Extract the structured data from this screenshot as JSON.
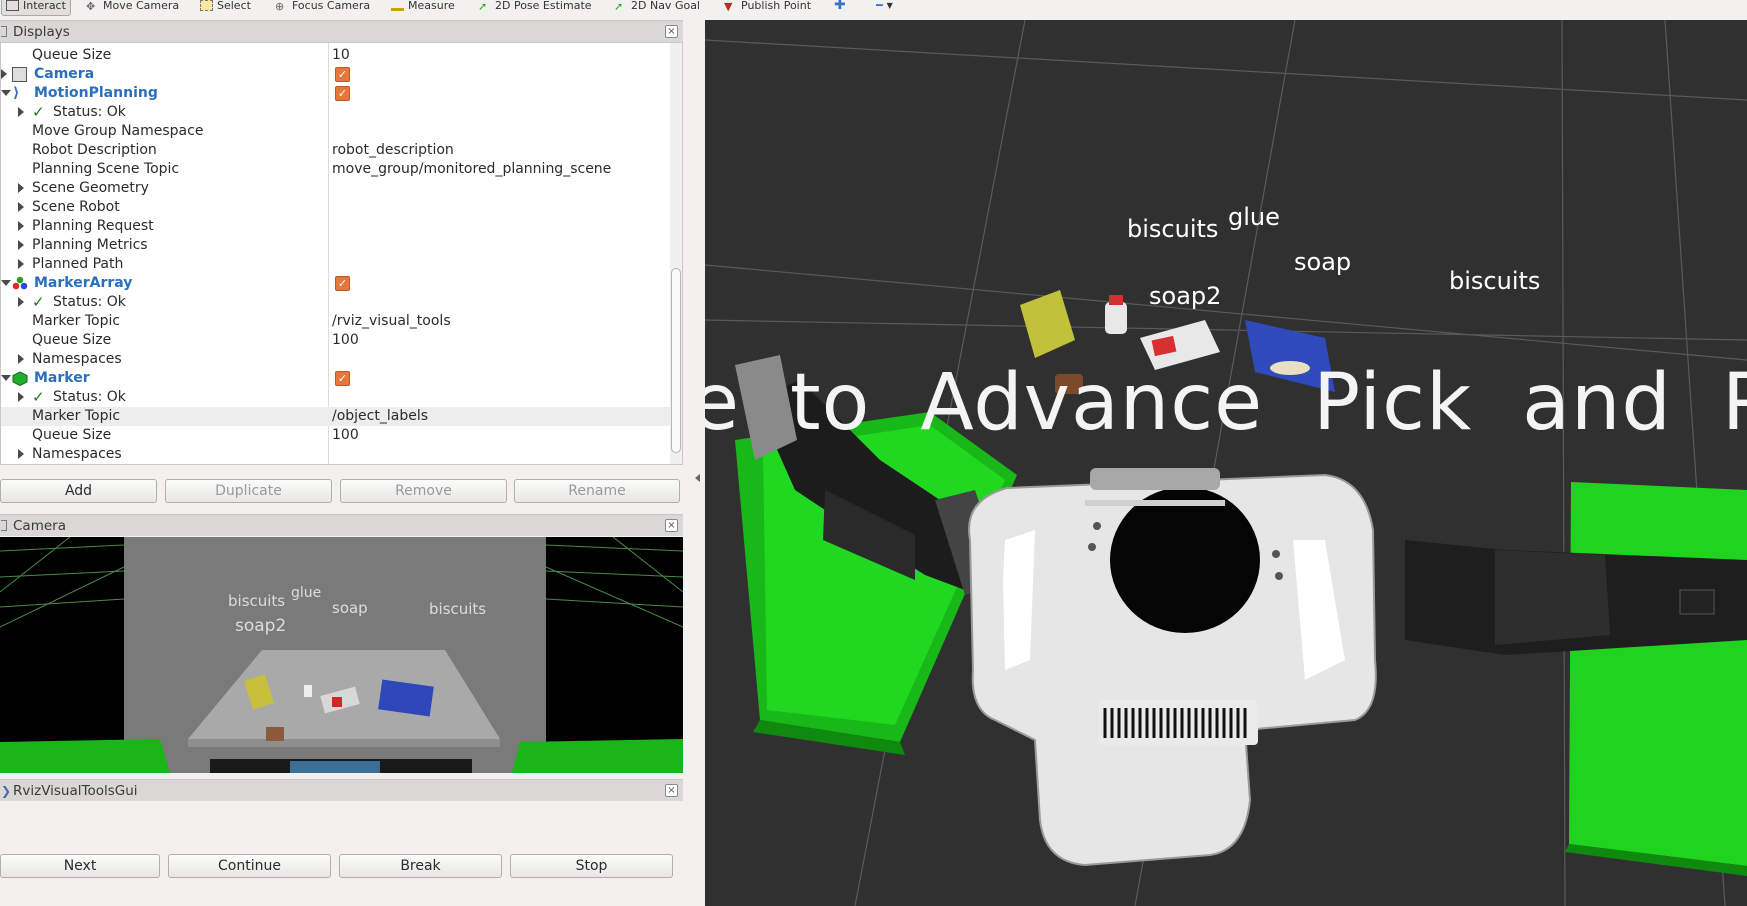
{
  "toolbar": {
    "tools": [
      "Interact",
      "Move Camera",
      "Select",
      "Focus Camera",
      "Measure",
      "2D Pose Estimate",
      "2D Nav Goal",
      "Publish Point"
    ]
  },
  "displays_panel": {
    "title": "Displays",
    "rows": [
      {
        "name": "Queue Size",
        "value": "10"
      },
      {
        "name": "Camera"
      },
      {
        "name": "MotionPlanning"
      },
      {
        "name": "Status: Ok"
      },
      {
        "name": "Move Group Namespace",
        "value": ""
      },
      {
        "name": "Robot Description",
        "value": "robot_description"
      },
      {
        "name": "Planning Scene Topic",
        "value": "move_group/monitored_planning_scene"
      },
      {
        "name": "Scene Geometry"
      },
      {
        "name": "Scene Robot"
      },
      {
        "name": "Planning Request"
      },
      {
        "name": "Planning Metrics"
      },
      {
        "name": "Planned Path"
      },
      {
        "name": "MarkerArray"
      },
      {
        "name": "Status: Ok"
      },
      {
        "name": "Marker Topic",
        "value": "/rviz_visual_tools"
      },
      {
        "name": "Queue Size",
        "value": "100"
      },
      {
        "name": "Namespaces"
      },
      {
        "name": "Marker"
      },
      {
        "name": "Status: Ok"
      },
      {
        "name": "Marker Topic",
        "value": "/object_labels"
      },
      {
        "name": "Queue Size",
        "value": "100"
      },
      {
        "name": "Namespaces"
      }
    ],
    "buttons": {
      "add": "Add",
      "duplicate": "Duplicate",
      "remove": "Remove",
      "rename": "Rename"
    }
  },
  "camera_panel": {
    "title": "Camera",
    "labels": {
      "biscuits1": "biscuits",
      "glue": "glue",
      "soap": "soap",
      "biscuits2": "biscuits",
      "soap2": "soap2"
    }
  },
  "rviz_tools_panel": {
    "title": "RvizVisualToolsGui",
    "buttons": {
      "next": "Next",
      "continue": "Continue",
      "break": "Break",
      "stop": "Stop"
    }
  },
  "view3d": {
    "labels": {
      "biscuits1": "biscuits",
      "glue": "glue",
      "soap": "soap",
      "soap2": "soap2",
      "biscuits2": "biscuits"
    },
    "banner": [
      "e",
      "to",
      "Advance",
      "Pick",
      "and",
      "Pla"
    ]
  },
  "colors": {
    "bin_green": "#19c419",
    "link_blue": "#2a6fbe",
    "checkbox_orange": "#e8763a",
    "grid_bg": "#303030"
  }
}
